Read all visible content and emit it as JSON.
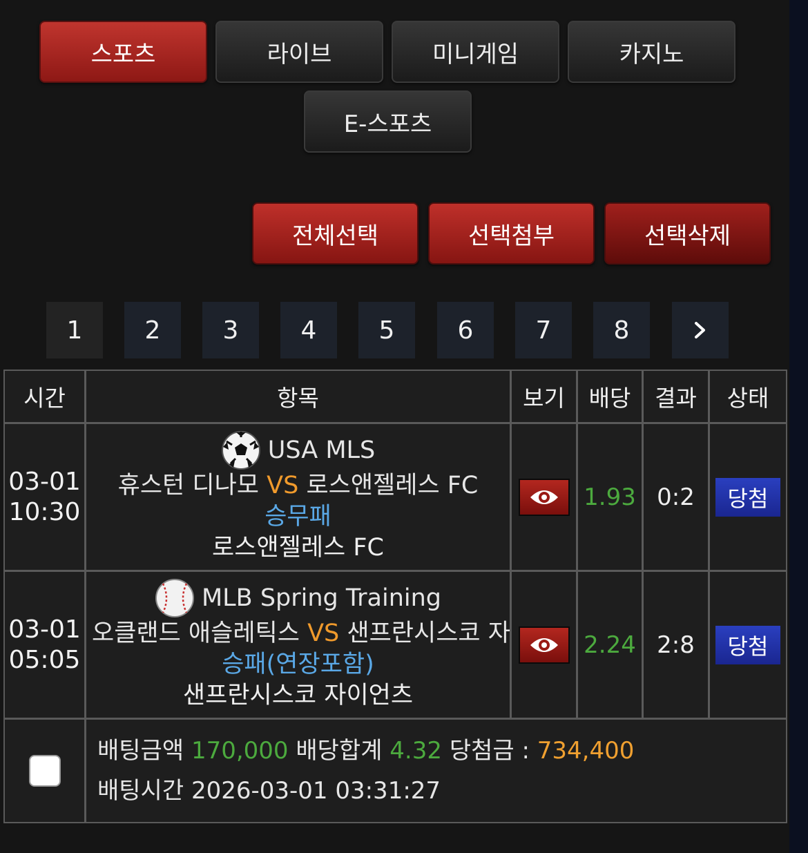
{
  "categories": [
    "스포츠",
    "라이브",
    "미니게임",
    "카지노",
    "E-스포츠"
  ],
  "actions": {
    "select_all": "전체선택",
    "attach": "선택첨부",
    "delete": "선택삭제"
  },
  "pagination": {
    "pages": [
      "1",
      "2",
      "3",
      "4",
      "5",
      "6",
      "7",
      "8"
    ],
    "current": "1",
    "next_icon": "chevron-right"
  },
  "table": {
    "headers": {
      "time": "시간",
      "item": "항목",
      "view": "보기",
      "odds": "배당",
      "result": "결과",
      "status": "상태"
    },
    "rows": [
      {
        "date": "03-01",
        "time": "10:30",
        "sport_icon": "soccer-ball",
        "league": "USA MLS",
        "home": "휴스턴 디나모",
        "vs": "VS",
        "away": "로스앤젤레스 FC",
        "bet_type": "승무패",
        "pick": "로스앤젤레스 FC",
        "odds": "1.93",
        "result": "0:2",
        "status": "당첨"
      },
      {
        "date": "03-01",
        "time": "05:05",
        "sport_icon": "baseball",
        "league": "MLB Spring Training",
        "home": "오클랜드 애슬레틱스",
        "vs": "VS",
        "away": "샌프란시스코 자이언츠",
        "bet_type": "승패(연장포함)",
        "pick": "샌프란시스코 자이언츠",
        "odds": "2.24",
        "result": "2:8",
        "status": "당첨"
      }
    ]
  },
  "summary": {
    "bet_amount_label": "배팅금액",
    "bet_amount": "170,000",
    "odds_total_label": "배당합계",
    "odds_total": "4.32",
    "win_label": "당첨금 :",
    "win_amount": "734,400",
    "bet_time_label": "배팅시간",
    "bet_time": "2026-03-01 03:31:27"
  },
  "colors": {
    "accent_red": "#a8231e",
    "odds_green": "#4caa3e",
    "vs_orange": "#f09a2c",
    "bet_type_blue": "#5aa8e6",
    "badge_blue": "#1f2fa8"
  }
}
